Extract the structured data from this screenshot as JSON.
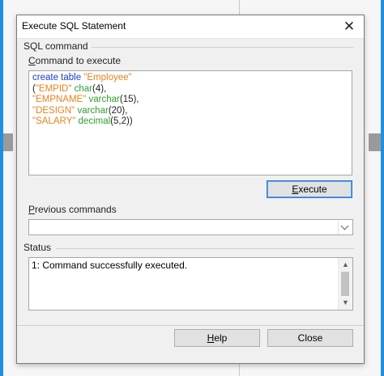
{
  "window": {
    "title": "Execute SQL Statement",
    "close_glyph": "✕"
  },
  "sql_command": {
    "group_label": "SQL command",
    "field_label": "Command to execute",
    "lines": [
      [
        {
          "t": "create table ",
          "c": "kw"
        },
        {
          "t": "\"Employee\"",
          "c": "str"
        }
      ],
      [
        {
          "t": "(",
          "c": "pn"
        },
        {
          "t": "\"EMPID\"",
          "c": "str"
        },
        {
          "t": " char",
          "c": "ty"
        },
        {
          "t": "(4),",
          "c": "pn"
        }
      ],
      [
        {
          "t": "\"EMPNAME\"",
          "c": "str"
        },
        {
          "t": " varchar",
          "c": "ty"
        },
        {
          "t": "(15),",
          "c": "pn"
        }
      ],
      [
        {
          "t": "\"DESIGN\"",
          "c": "str"
        },
        {
          "t": " varchar",
          "c": "ty"
        },
        {
          "t": "(20),",
          "c": "pn"
        }
      ],
      [
        {
          "t": "\"SALARY\"",
          "c": "str"
        },
        {
          "t": " decimal",
          "c": "ty"
        },
        {
          "t": "(5,2))",
          "c": "pn"
        }
      ]
    ],
    "execute_label": "Execute"
  },
  "previous": {
    "label": "Previous commands",
    "selected": ""
  },
  "status": {
    "label": "Status",
    "text": "1: Command successfully executed."
  },
  "footer": {
    "help_label": "Help",
    "close_label": "Close"
  },
  "colors": {
    "keyword": "#1a3cd6",
    "string": "#e6821e",
    "type": "#2f9e2f",
    "default_button_border": "#2a7ad1",
    "desktop_blue": "#2aa1ee"
  },
  "icons": {
    "close": "close-icon",
    "combo_dropdown": "chevron-down-icon",
    "scroll_up": "scroll-up-icon",
    "scroll_down": "scroll-down-icon"
  }
}
